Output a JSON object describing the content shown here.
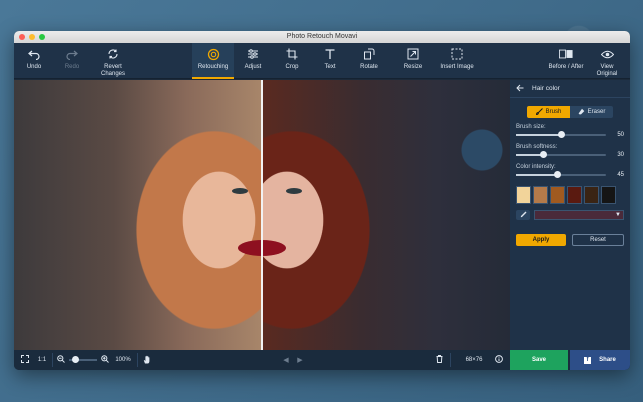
{
  "window": {
    "title": "Photo Retouch Movavi"
  },
  "toolbar": {
    "undo": "Undo",
    "redo": "Redo",
    "revert": "Revert Changes",
    "retouching": "Retouching",
    "adjust": "Adjust",
    "crop": "Crop",
    "text": "Text",
    "rotate": "Rotate",
    "resize": "Resize",
    "insert": "Insert Image",
    "before_after": "Before / After",
    "view_original": "View Original"
  },
  "panel": {
    "title": "Hair color",
    "brush": "Brush",
    "eraser": "Eraser",
    "brush_size": {
      "label": "Brush size:",
      "value": "50",
      "fraction": 0.5
    },
    "brush_softness": {
      "label": "Brush softness:",
      "value": "30",
      "fraction": 0.3
    },
    "color_intensity": {
      "label": "Color intensity:",
      "value": "45",
      "fraction": 0.45
    },
    "swatches": [
      "#f2d49a",
      "#b47a4a",
      "#a05a20",
      "#5a1a10",
      "#3a2414",
      "#151515"
    ],
    "selected_color": "#4a2a3a",
    "apply": "Apply",
    "reset": "Reset"
  },
  "bottom": {
    "ratio": "1:1",
    "zoom": "100%",
    "size": "68×76",
    "save": "Save",
    "share": "Share"
  }
}
